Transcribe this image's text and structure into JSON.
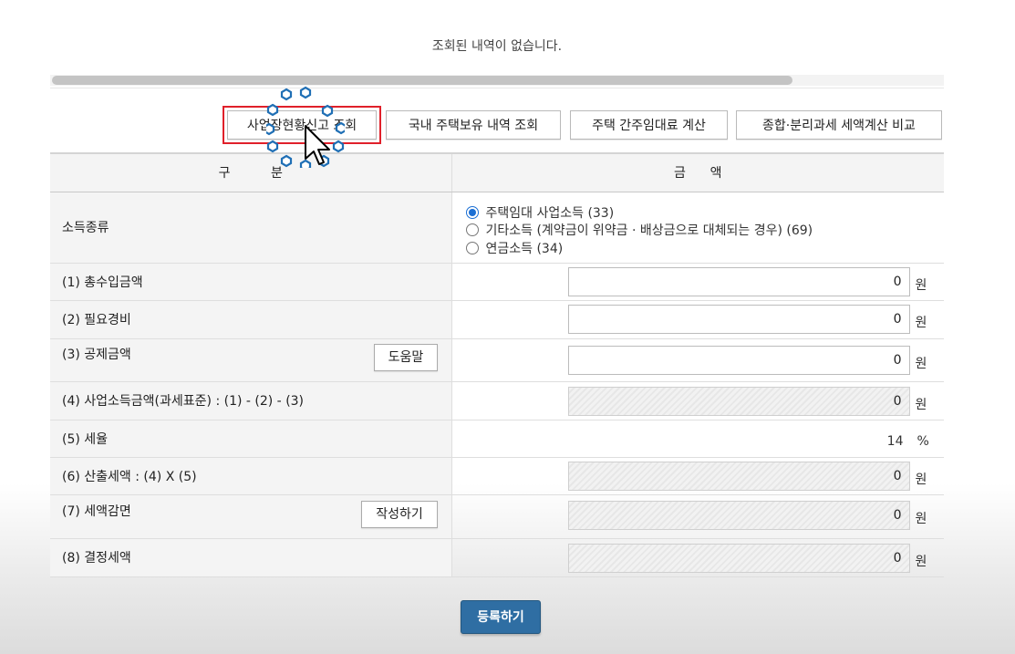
{
  "message": "조회된 내역이 없습니다.",
  "toolbar": {
    "buttons": [
      {
        "label": "사업장현황신고 조회"
      },
      {
        "label": "국내 주택보유 내역 조회"
      },
      {
        "label": "주택 간주임대료 계산"
      },
      {
        "label": "종합·분리과세 세액계산 비교"
      }
    ]
  },
  "table": {
    "header_left": "구          분",
    "header_right": "금      액",
    "income_type": {
      "label": "소득종류",
      "options": [
        {
          "label": "주택임대 사업소득 (33)",
          "selected": true
        },
        {
          "label": "기타소득 (계약금이 위약금 · 배상금으로 대체되는 경우) (69)",
          "selected": false
        },
        {
          "label": "연금소득 (34)",
          "selected": false
        }
      ]
    },
    "rows": [
      {
        "label": "(1) 총수입금액",
        "value": "0",
        "unit": "원"
      },
      {
        "label": "(2) 필요경비",
        "value": "0",
        "unit": "원"
      },
      {
        "label": "(3) 공제금액",
        "value": "0",
        "unit": "원",
        "button": "도움말"
      },
      {
        "label": "(4) 사업소득금액(과세표준) : (1) - (2) - (3)",
        "value": "0",
        "unit": "원"
      },
      {
        "label": "(5) 세율",
        "value": "14",
        "unit": "%"
      },
      {
        "label": "(6) 산출세액 : (4) X (5)",
        "value": "0",
        "unit": "원"
      },
      {
        "label": "(7) 세액감면",
        "value": "0",
        "unit": "원",
        "button": "작성하기"
      },
      {
        "label": "(8) 결정세액",
        "value": "0",
        "unit": "원"
      }
    ]
  },
  "submit_label": "등록하기",
  "colors": {
    "primary": "#2f6ea3",
    "highlight": "#e0202a",
    "radio": "#1b6fd4"
  }
}
